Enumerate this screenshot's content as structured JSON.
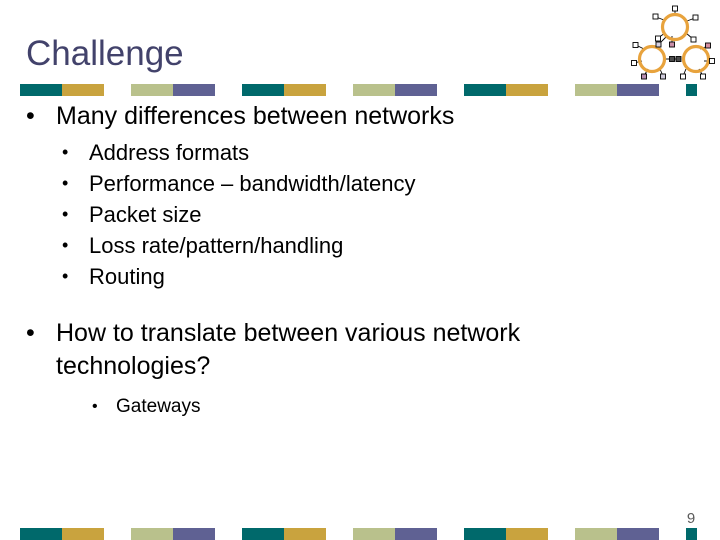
{
  "slide": {
    "title": "Challenge",
    "page_number": "9",
    "colors": {
      "title": "#42426B",
      "teal": "#00696B",
      "gold": "#C9A33E",
      "sage": "#B9C18C",
      "purple": "#5F6193",
      "clipart_ring": "#E8A33D",
      "clipart_node": "#FFFFFF",
      "clipart_node_border": "#000000",
      "body_text": "#000000"
    },
    "decor_bar_pattern": [
      "teal",
      "gold",
      "gap",
      "sage",
      "purple",
      "gap"
    ],
    "clipart_name": "three-ring-networks-diagram"
  },
  "body": {
    "bullet_marker": "•",
    "groups": [
      {
        "level": 1,
        "items": [
          {
            "text": "Many differences between networks"
          }
        ]
      },
      {
        "level": 2,
        "items": [
          {
            "text": "Address formats"
          },
          {
            "text": "Performance – bandwidth/latency"
          },
          {
            "text": "Packet size"
          },
          {
            "text": "Loss rate/pattern/handling"
          },
          {
            "text": "Routing"
          }
        ]
      },
      {
        "level": 1,
        "items": [
          {
            "text": "How to translate between various network technologies?"
          }
        ]
      },
      {
        "level": 3,
        "items": [
          {
            "text": "Gateways"
          }
        ]
      }
    ]
  }
}
